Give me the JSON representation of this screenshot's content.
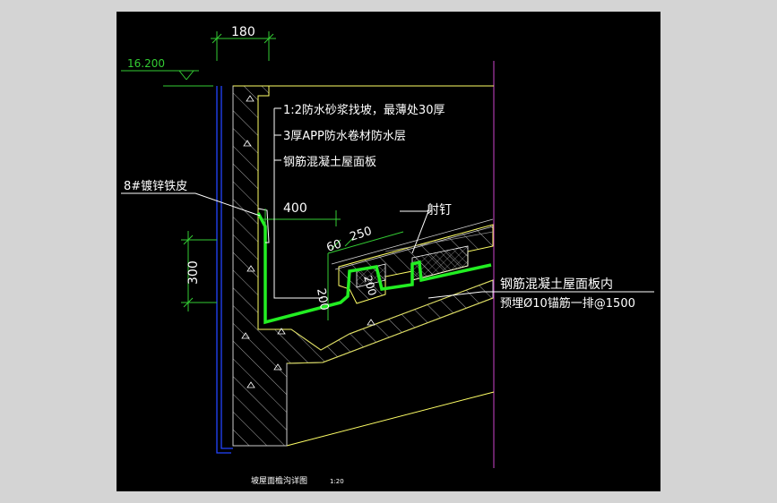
{
  "drawing": {
    "title": "坡屋面檐沟详图",
    "scale": "1:20",
    "elevation": "16.200",
    "dims": {
      "top_width": "180",
      "gutter_width": "400",
      "d60": "60",
      "d250": "250",
      "d200a": "200",
      "d200b": "200",
      "d300": "300"
    },
    "callouts": {
      "layer1": "1:2防水砂浆找坡，最薄处30厚",
      "layer2": "3厚APP防水卷材防水层",
      "layer3": "钢筋混凝土屋面板",
      "galv": "8#镀锌铁皮",
      "nail": "射钉",
      "anchor1": "钢筋混凝土屋面板内",
      "anchor2": "预埋Ø10锚筋一排@1500"
    }
  },
  "colors": {
    "background": "#000000",
    "frame": "#d4d4d4",
    "text": "#ffffff",
    "dimension": "#33cc33",
    "membrane": "#22ee22",
    "outline": "#ffff66",
    "guide": "#cc44cc",
    "edge": "#2244ff"
  }
}
